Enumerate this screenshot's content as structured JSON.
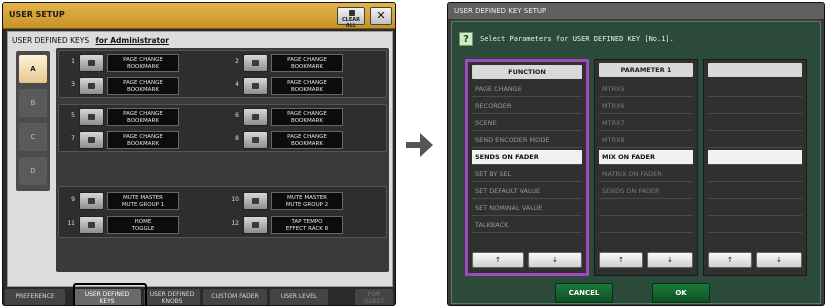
{
  "left_window": {
    "title": "USER SETUP",
    "clear_all_label": "CLEAR ALL",
    "close_label": "✕",
    "heading": "USER DEFINED KEYS",
    "heading_user": "for Administrator",
    "user_tabs": [
      "A",
      "B",
      "C",
      "D"
    ],
    "keys": [
      {
        "num": "1",
        "label1": "PAGE CHANGE",
        "label2": "BOOKMARK"
      },
      {
        "num": "2",
        "label1": "PAGE CHANGE",
        "label2": "BOOKMARK"
      },
      {
        "num": "3",
        "label1": "PAGE CHANGE",
        "label2": "BOOKMARK"
      },
      {
        "num": "4",
        "label1": "PAGE CHANGE",
        "label2": "BOOKMARK"
      },
      {
        "num": "5",
        "label1": "PAGE CHANGE",
        "label2": "BOOKMARK"
      },
      {
        "num": "6",
        "label1": "PAGE CHANGE",
        "label2": "BOOKMARK"
      },
      {
        "num": "7",
        "label1": "PAGE CHANGE",
        "label2": "BOOKMARK"
      },
      {
        "num": "8",
        "label1": "PAGE CHANGE",
        "label2": "BOOKMARK"
      },
      {
        "num": "9",
        "label1": "MUTE MASTER",
        "label2": "MUTE GROUP 1"
      },
      {
        "num": "10",
        "label1": "MUTE MASTER",
        "label2": "MUTE GROUP 2"
      },
      {
        "num": "11",
        "label1": "HOME",
        "label2": "TOGGLE"
      },
      {
        "num": "12",
        "label1": "TAP TEMPO",
        "label2": "EFFECT RACK 8"
      }
    ],
    "bottom_tabs": {
      "preference": "PREFERENCE",
      "udk_1": "USER DEFINED",
      "udk_2": "KEYS",
      "knobs_1": "USER DEFINED",
      "knobs_2": "KNOBS",
      "custom_fader": "CUSTOM FADER",
      "user_level": "USER LEVEL",
      "guest_1": "FOR",
      "guest_2": "GUEST"
    }
  },
  "right_window": {
    "title": "USER DEFINED KEY SETUP",
    "help_icon": "?",
    "prompt": "Select Parameters for USER DEFINED KEY [No.1].",
    "function_header": "FUNCTION",
    "parameter1_header": "PARAMETER 1",
    "function_items": [
      "PAGE CHANGE",
      "RECORDER",
      "SCENE",
      "SEND ENCODER MODE",
      "SENDS ON FADER",
      "SET BY SEL",
      "SET DEFAULT VALUE",
      "SET NOMINAL VALUE",
      "TALKBACK"
    ],
    "function_selected": "SENDS ON FADER",
    "parameter1_items": [
      "MTRX5",
      "MTRX6",
      "MTRX7",
      "MTRX8",
      "MIX ON FADER",
      "MATRIX ON FADER",
      "SENDS ON FADER"
    ],
    "parameter1_selected": "MIX ON FADER",
    "arrow_up": "↑",
    "arrow_down": "↓",
    "cancel_label": "CANCEL",
    "ok_label": "OK"
  }
}
